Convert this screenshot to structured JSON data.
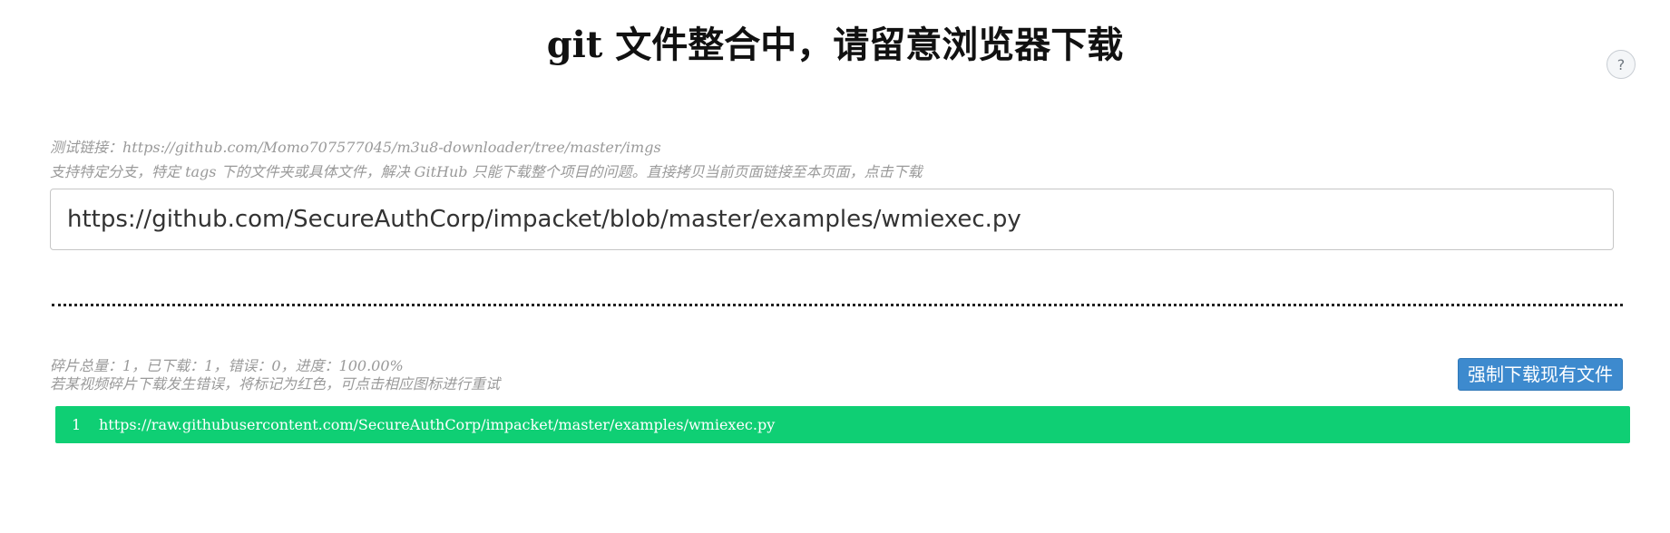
{
  "header": {
    "title": "git 文件整合中，请留意浏览器下载",
    "help_label": "?"
  },
  "hints": {
    "test_link": "测试链接：https://github.com/Momo707577045/m3u8-downloader/tree/master/imgs",
    "description": "支持特定分支，特定 tags 下的文件夹或具体文件，解决 GitHub 只能下载整个项目的问题。直接拷贝当前页面链接至本页面，点击下载"
  },
  "url_input": {
    "value": "https://github.com/SecureAuthCorp/impacket/blob/master/examples/wmiexec.py"
  },
  "status": {
    "summary": "碎片总量：1，已下载：1，错误：0，进度：100.00%",
    "error_hint": "若某视频碎片下载发生错误，将标记为红色，可点击相应图标进行重试"
  },
  "actions": {
    "force_download_label": "强制下载现有文件"
  },
  "files": [
    {
      "index": "1",
      "url": "https://raw.githubusercontent.com/SecureAuthCorp/impacket/master/examples/wmiexec.py",
      "status_color": "#0fcf74"
    }
  ],
  "colors": {
    "accent_button": "#3d8ace",
    "success_row": "#0fcf74"
  }
}
